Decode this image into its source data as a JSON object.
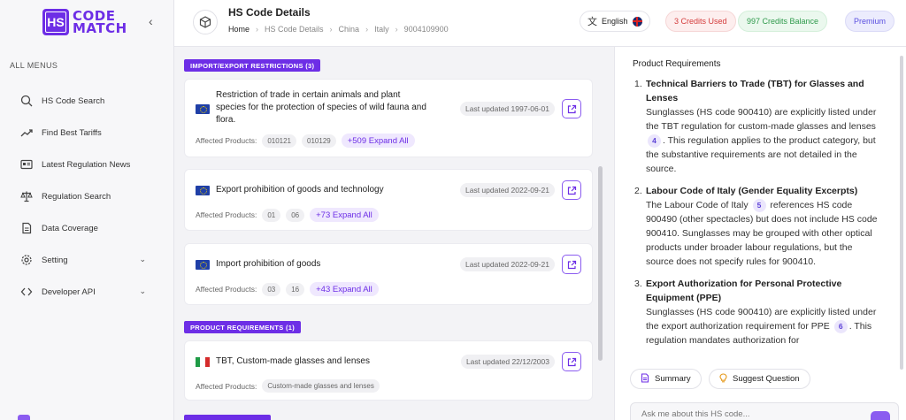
{
  "sidebar": {
    "logo_mark": "HS",
    "logo_line1": "CODE",
    "logo_line2": "MATCH",
    "menu_title": "ALL MENUS",
    "items": [
      {
        "label": "HS Code Search",
        "icon": "search-icon"
      },
      {
        "label": "Find Best Tariffs",
        "icon": "trend-icon"
      },
      {
        "label": "Latest Regulation News",
        "icon": "news-icon"
      },
      {
        "label": "Regulation Search",
        "icon": "scales-icon"
      },
      {
        "label": "Data Coverage",
        "icon": "document-icon"
      },
      {
        "label": "Setting",
        "icon": "gear-icon"
      },
      {
        "label": "Developer API",
        "icon": "code-icon"
      }
    ]
  },
  "header": {
    "title": "HS Code Details",
    "breadcrumb": [
      "Home",
      "HS Code Details",
      "China",
      "Italy",
      "9004109900"
    ],
    "language": "English",
    "credits_used": "3 Credits Used",
    "credits_balance": "997 Credits Balance",
    "plan": "Premium"
  },
  "sections": {
    "import_export": "IMPORT/EXPORT RESTRICTIONS (3)",
    "product_requirements": "PRODUCT REQUIREMENTS (1)"
  },
  "affected_label": "Affected Products:",
  "cards": [
    {
      "title_l1": "Restriction of trade in certain animals and plant",
      "title_l2": "species for the protection of species of wild fauna and",
      "title_l3": "flora.",
      "updated": "Last updated 1997-06-01",
      "chips": [
        "010121",
        "010129"
      ],
      "expand": "+509 Expand All"
    },
    {
      "title": "Export prohibition of goods and technology",
      "updated": "Last updated 2022-09-21",
      "chips": [
        "01",
        "06"
      ],
      "expand": "+73 Expand All"
    },
    {
      "title": "Import prohibition of goods",
      "updated": "Last updated 2022-09-21",
      "chips": [
        "03",
        "16"
      ],
      "expand": "+43 Expand All"
    },
    {
      "title": "TBT, Custom-made glasses and lenses",
      "updated": "Last updated 22/12/2003",
      "chips": [
        "Custom-made glasses and lenses"
      ]
    }
  ],
  "panel": {
    "title": "Product Requirements",
    "requirements": [
      {
        "num": "1.",
        "heading": "Technical Barriers to Trade (TBT) for Glasses and Lenses",
        "text_a": "Sunglasses (HS code 900410) are explicitly listed under the TBT regulation for custom-made glasses and lenses",
        "cite": "4",
        "text_b": ". This regulation applies to the product category, but the substantive requirements are not detailed in the source."
      },
      {
        "num": "2.",
        "heading": "Labour Code of Italy (Gender Equality Excerpts)",
        "text_a": "The Labour Code of Italy",
        "cite": "5",
        "text_b": "references HS code 900490 (other spectacles) but does not include HS code 900410. Sunglasses may be grouped with other optical products under broader labour regulations, but the source does not specify rules for 900410."
      },
      {
        "num": "3.",
        "heading": "Export Authorization for Personal Protective Equipment (PPE)",
        "text_a": "Sunglasses (HS code 900410) are explicitly listed under the export authorization requirement for PPE",
        "cite": "6",
        "text_b": ". This regulation mandates authorization for"
      }
    ],
    "summary_button": "Summary",
    "suggest_button": "Suggest Question",
    "ask_placeholder": "Ask me about this HS code..."
  },
  "colors": {
    "brand": "#6d2ee6",
    "danger": "#d43c3c",
    "success": "#2f9a4c",
    "premium": "#5a4fe0"
  }
}
